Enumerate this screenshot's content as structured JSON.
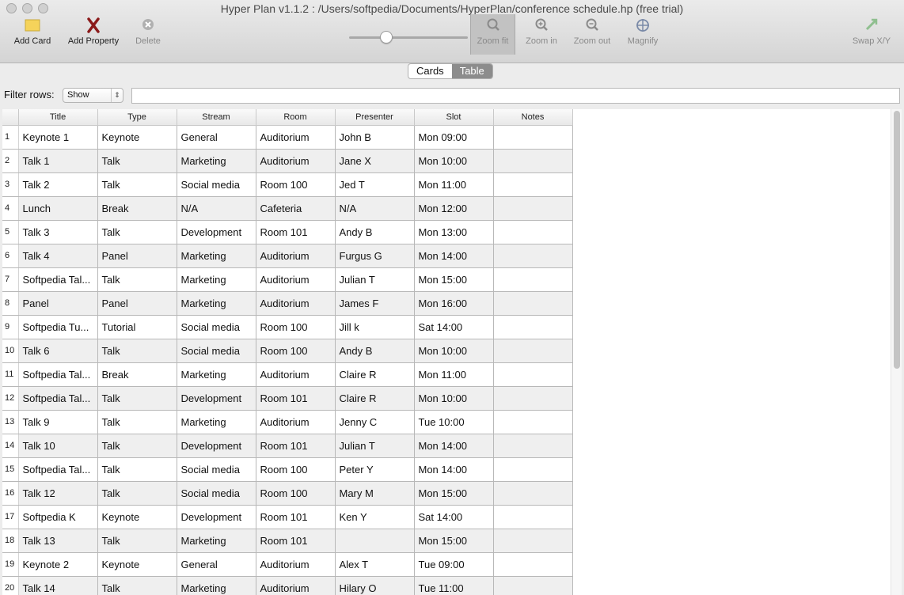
{
  "window": {
    "title": "Hyper Plan v1.1.2 : /Users/softpedia/Documents/HyperPlan/conference schedule.hp (free trial)"
  },
  "toolbar": {
    "add_card": "Add Card",
    "add_property": "Add Property",
    "delete": "Delete",
    "zoom_fit": "Zoom fit",
    "zoom_in": "Zoom in",
    "zoom_out": "Zoom out",
    "magnify": "Magnify",
    "swap_xy": "Swap X/Y",
    "zoom_level": 0.29
  },
  "views": {
    "cards": "Cards",
    "table": "Table",
    "selected": "Table"
  },
  "filter": {
    "label": "Filter rows:",
    "mode": "Show",
    "value": ""
  },
  "table": {
    "columns": [
      "Title",
      "Type",
      "Stream",
      "Room",
      "Presenter",
      "Slot",
      "Notes"
    ],
    "rows": [
      [
        "1",
        "Keynote 1",
        "Keynote",
        "General",
        "Auditorium",
        "John B",
        "Mon 09:00",
        ""
      ],
      [
        "2",
        "Talk 1",
        "Talk",
        "Marketing",
        "Auditorium",
        "Jane X",
        "Mon 10:00",
        ""
      ],
      [
        "3",
        "Talk 2",
        "Talk",
        "Social media",
        "Room 100",
        "Jed T",
        "Mon 11:00",
        ""
      ],
      [
        "4",
        "Lunch",
        "Break",
        "N/A",
        "Cafeteria",
        "N/A",
        "Mon 12:00",
        ""
      ],
      [
        "5",
        "Talk 3",
        "Talk",
        "Development",
        "Room 101",
        "Andy B",
        "Mon 13:00",
        ""
      ],
      [
        "6",
        " Talk 4",
        "Panel",
        "Marketing",
        "Auditorium",
        "Furgus G",
        "Mon 14:00",
        ""
      ],
      [
        "7",
        "Softpedia Tal...",
        "Talk",
        "Marketing",
        "Auditorium",
        "Julian T",
        "Mon 15:00",
        ""
      ],
      [
        "8",
        "Panel",
        "Panel",
        "Marketing",
        "Auditorium",
        "James F",
        "Mon 16:00",
        ""
      ],
      [
        "9",
        "Softpedia Tu...",
        "Tutorial",
        "Social media",
        "Room 100",
        "Jill k",
        "Sat 14:00",
        ""
      ],
      [
        "10",
        "Talk 6",
        "Talk",
        "Social media",
        "Room 100",
        "Andy B",
        "Mon 10:00",
        ""
      ],
      [
        "11",
        "Softpedia Tal...",
        "Break",
        "Marketing",
        "Auditorium",
        "Claire R",
        "Mon 11:00",
        ""
      ],
      [
        "12",
        "Softpedia Tal...",
        "Talk",
        "Development",
        "Room 101",
        "Claire R",
        "Mon 10:00",
        ""
      ],
      [
        "13",
        "Talk 9",
        "Talk",
        "Marketing",
        "Auditorium",
        "Jenny C",
        "Tue 10:00",
        ""
      ],
      [
        "14",
        "Talk 10",
        "Talk",
        "Development",
        "Room 101",
        "Julian T",
        "Mon 14:00",
        ""
      ],
      [
        "15",
        "Softpedia Tal...",
        "Talk",
        "Social media",
        "Room 100",
        "Peter Y",
        "Mon 14:00",
        ""
      ],
      [
        "16",
        "Talk 12",
        "Talk",
        "Social media",
        "Room 100",
        "Mary M",
        "Mon 15:00",
        ""
      ],
      [
        "17",
        "Softpedia K",
        "Keynote",
        "Development",
        "Room 101",
        "Ken Y",
        "Sat 14:00",
        ""
      ],
      [
        "18",
        "Talk 13",
        "Talk",
        "Marketing",
        "Room 101",
        "",
        "Mon 15:00",
        ""
      ],
      [
        "19",
        "Keynote 2",
        "Keynote",
        "General",
        "Auditorium",
        "Alex T",
        "Tue 09:00",
        ""
      ],
      [
        "20",
        "Talk 14",
        "Talk",
        "Marketing",
        "Auditorium",
        "Hilary O",
        "Tue 11:00",
        ""
      ]
    ]
  }
}
